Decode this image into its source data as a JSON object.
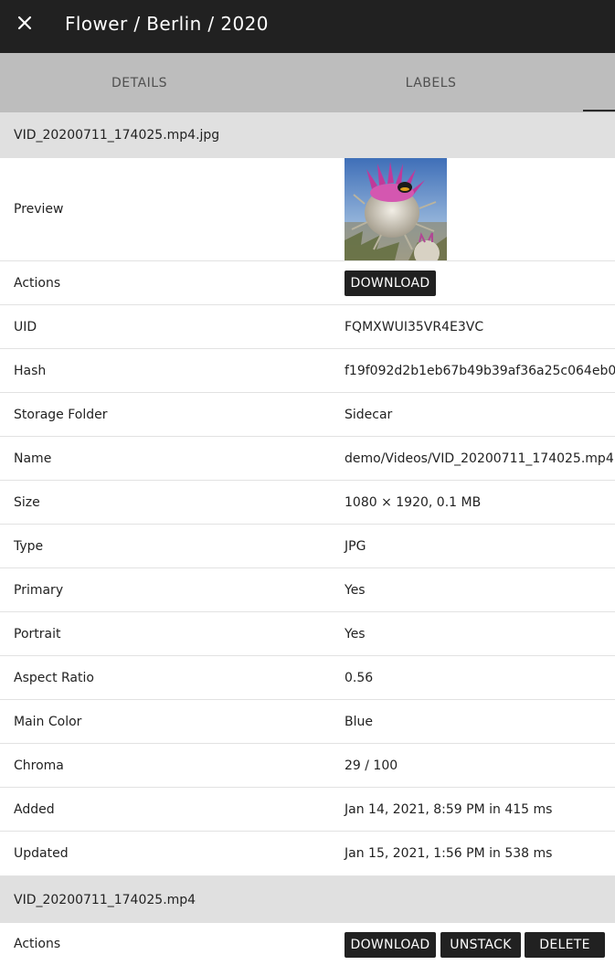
{
  "header": {
    "title": "Flower / Berlin / 2020"
  },
  "tabs": [
    {
      "label": "DETAILS"
    },
    {
      "label": "LABELS"
    }
  ],
  "image_file": {
    "name": "VID_20200711_174025.mp4.jpg",
    "preview_label": "Preview",
    "actions_label": "Actions",
    "download_label": "DOWNLOAD",
    "fields": [
      {
        "label": "UID",
        "value": "FQMXWUI35VR4E3VC"
      },
      {
        "label": "Hash",
        "value": "f19f092d2b1eb67b49b39af36a25c064eb0"
      },
      {
        "label": "Storage Folder",
        "value": "Sidecar"
      },
      {
        "label": "Name",
        "value": "demo/Videos/VID_20200711_174025.mp4."
      },
      {
        "label": "Size",
        "value": "1080 × 1920, 0.1 MB"
      },
      {
        "label": "Type",
        "value": "JPG"
      },
      {
        "label": "Primary",
        "value": "Yes"
      },
      {
        "label": "Portrait",
        "value": "Yes"
      },
      {
        "label": "Aspect Ratio",
        "value": "0.56"
      },
      {
        "label": "Main Color",
        "value": "Blue"
      },
      {
        "label": "Chroma",
        "value": "29 / 100"
      },
      {
        "label": "Added",
        "value": "Jan 14, 2021, 8:59 PM in 415 ms"
      },
      {
        "label": "Updated",
        "value": "Jan 15, 2021, 1:56 PM in 538 ms"
      }
    ]
  },
  "video_file": {
    "name": "VID_20200711_174025.mp4",
    "actions_label": "Actions",
    "download_label": "DOWNLOAD",
    "unstack_label": "UNSTACK",
    "delete_label": "DELETE"
  }
}
